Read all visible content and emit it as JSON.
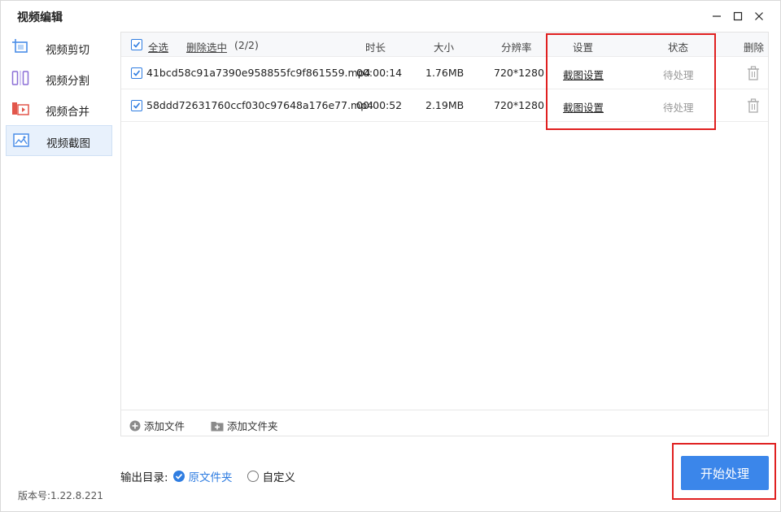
{
  "window": {
    "title": "视频编辑"
  },
  "sidebar": {
    "items": [
      {
        "label": "视频剪切",
        "icon": "crop-icon",
        "active": false
      },
      {
        "label": "视频分割",
        "icon": "split-icon",
        "active": false
      },
      {
        "label": "视频合并",
        "icon": "merge-icon",
        "active": false
      },
      {
        "label": "视频截图",
        "icon": "screenshot-icon",
        "active": true
      }
    ]
  },
  "table": {
    "select_all_label": "全选",
    "delete_selected_label": "删除选中",
    "selected_count": "(2/2)",
    "columns": {
      "duration": "时长",
      "size": "大小",
      "resolution": "分辨率",
      "settings": "设置",
      "status": "状态",
      "delete": "删除"
    },
    "rows": [
      {
        "filename": "41bcd58c91a7390e958855fc9f861559.mp4",
        "duration": "00:00:14",
        "size": "1.76MB",
        "resolution": "720*1280",
        "settings": "截图设置",
        "status": "待处理"
      },
      {
        "filename": "58ddd72631760ccf030c97648a176e77.mp4",
        "duration": "00:00:52",
        "size": "2.19MB",
        "resolution": "720*1280",
        "settings": "截图设置",
        "status": "待处理"
      }
    ],
    "footer": {
      "add_file": "添加文件",
      "add_folder": "添加文件夹"
    }
  },
  "output": {
    "label": "输出目录:",
    "options": [
      {
        "label": "原文件夹",
        "selected": true
      },
      {
        "label": "自定义",
        "selected": false
      }
    ]
  },
  "version": "版本号:1.22.8.221",
  "start_button": "开始处理",
  "colors": {
    "accent": "#3b86ea",
    "highlight": "#e02020",
    "active_bg": "#e8f1fc"
  }
}
